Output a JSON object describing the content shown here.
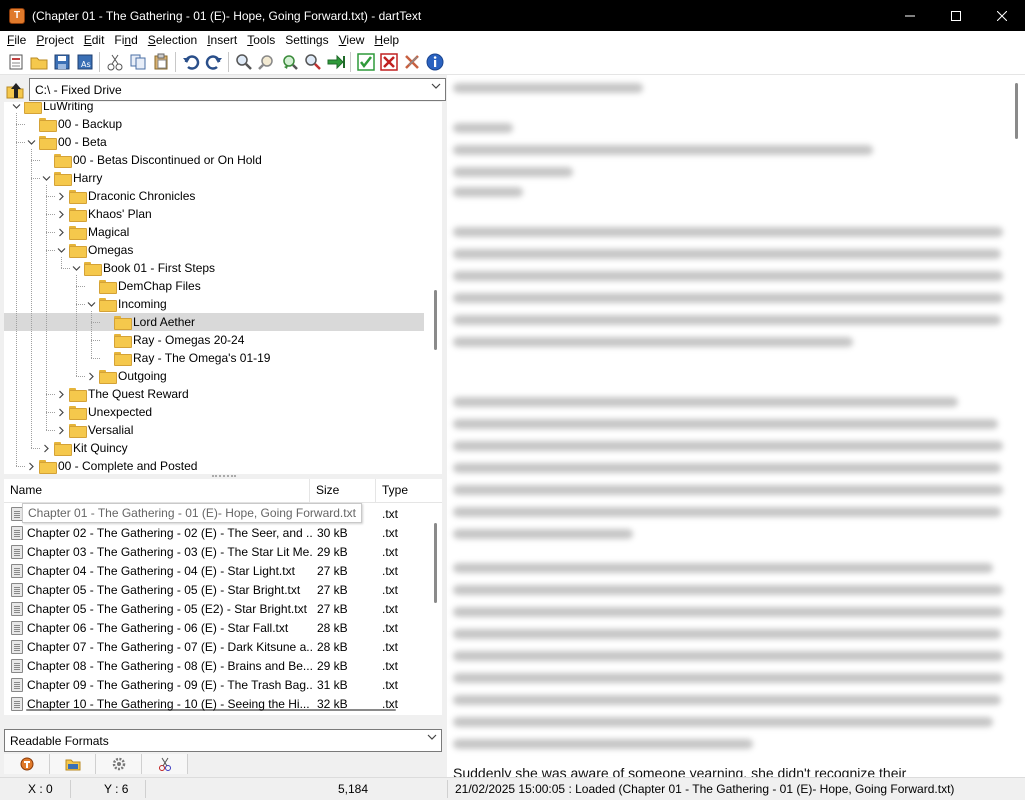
{
  "window": {
    "title": "(Chapter 01 - The Gathering - 01  (E)- Hope, Going Forward.txt) - dartText",
    "minimize": "—",
    "maximize": "☐",
    "close": "✕"
  },
  "menu": [
    {
      "label": "File",
      "key": "F"
    },
    {
      "label": "Project",
      "key": "P"
    },
    {
      "label": "Edit",
      "key": "E"
    },
    {
      "label": "Find",
      "key": "n"
    },
    {
      "label": "Selection",
      "key": "S"
    },
    {
      "label": "Insert",
      "key": "I"
    },
    {
      "label": "Tools",
      "key": "T"
    },
    {
      "label": "Settings",
      "key": "g"
    },
    {
      "label": "View",
      "key": "V"
    },
    {
      "label": "Help",
      "key": "H"
    }
  ],
  "toolbar": {
    "icons": [
      "new-document-icon",
      "open-folder-icon",
      "save-icon",
      "save-as-icon",
      "cut-icon",
      "copy-icon",
      "paste-icon",
      "undo-icon",
      "redo-icon",
      "find-icon",
      "find-next-icon",
      "replace-icon",
      "zoom-icon",
      "goto-icon",
      "accept-icon",
      "reject-icon",
      "remove-icon",
      "info-icon"
    ]
  },
  "drive": {
    "label": "C:\\ - Fixed Drive"
  },
  "tree": [
    {
      "label": "LuWriting",
      "level": 0,
      "expanded": true
    },
    {
      "label": "00 - Backup",
      "level": 1,
      "expanded": null
    },
    {
      "label": "00 - Beta",
      "level": 1,
      "expanded": true
    },
    {
      "label": "00 - Betas Discontinued or On Hold",
      "level": 2,
      "expanded": null
    },
    {
      "label": "Harry",
      "level": 2,
      "expanded": true
    },
    {
      "label": "Draconic Chronicles",
      "level": 3,
      "expanded": false
    },
    {
      "label": "Khaos' Plan",
      "level": 3,
      "expanded": false
    },
    {
      "label": "Magical",
      "level": 3,
      "expanded": false
    },
    {
      "label": "Omegas",
      "level": 3,
      "expanded": true
    },
    {
      "label": "Book 01 - First Steps",
      "level": 4,
      "expanded": true
    },
    {
      "label": "DemChap Files",
      "level": 5,
      "expanded": null
    },
    {
      "label": "Incoming",
      "level": 5,
      "expanded": true
    },
    {
      "label": "Lord Aether",
      "level": 6,
      "expanded": null,
      "selected": true
    },
    {
      "label": "Ray - Omegas 20-24",
      "level": 6,
      "expanded": null
    },
    {
      "label": "Ray - The Omega's 01-19",
      "level": 6,
      "expanded": null
    },
    {
      "label": "Outgoing",
      "level": 5,
      "expanded": false
    },
    {
      "label": "The Quest Reward",
      "level": 3,
      "expanded": false
    },
    {
      "label": "Unexpected",
      "level": 3,
      "expanded": false
    },
    {
      "label": "Versalial",
      "level": 3,
      "expanded": false
    },
    {
      "label": "Kit Quincy",
      "level": 2,
      "expanded": false
    },
    {
      "label": "00 - Complete and Posted",
      "level": 1,
      "expanded": false
    }
  ],
  "files": {
    "headers": {
      "name": "Name",
      "size": "Size",
      "type": "Type"
    },
    "tooltip": "Chapter 01 - The Gathering - 01  (E)- Hope, Going Forward.txt",
    "rows": [
      {
        "name": "Chapter 01 - The Gathering - 01  (E)- Hope, Going Forward.txt",
        "size": "",
        "type": ".txt"
      },
      {
        "name": "Chapter 02 - The Gathering - 02 (E) - The Seer, and ...",
        "size": "30 kB",
        "type": ".txt"
      },
      {
        "name": "Chapter 03 - The Gathering - 03 (E) - The Star Lit Me...",
        "size": "29 kB",
        "type": ".txt"
      },
      {
        "name": "Chapter 04 - The Gathering - 04 (E) - Star Light.txt",
        "size": "27 kB",
        "type": ".txt"
      },
      {
        "name": "Chapter 05 - The Gathering - 05  (E) - Star Bright.txt",
        "size": "27 kB",
        "type": ".txt"
      },
      {
        "name": "Chapter 05 - The Gathering - 05  (E2) - Star Bright.txt",
        "size": "27 kB",
        "type": ".txt"
      },
      {
        "name": "Chapter 06 - The Gathering - 06 (E)  - Star Fall.txt",
        "size": "28 kB",
        "type": ".txt"
      },
      {
        "name": "Chapter 07 - The Gathering - 07  (E) - Dark Kitsune a...",
        "size": "28 kB",
        "type": ".txt"
      },
      {
        "name": "Chapter 08 - The Gathering - 08 (E)  - Brains and Be...",
        "size": "29 kB",
        "type": ".txt"
      },
      {
        "name": "Chapter 09 - The Gathering - 09 (E)  - The Trash Bag...",
        "size": "31 kB",
        "type": ".txt"
      },
      {
        "name": "Chapter 10 - The Gathering - 10 (E)  - Seeing the Hi...",
        "size": "32 kB",
        "type": ".txt"
      }
    ]
  },
  "format": {
    "label": "Readable Formats"
  },
  "left_tabs": [
    "app-tab-icon",
    "folder-tab-icon",
    "gear-tab-icon",
    "clip-tab-icon"
  ],
  "editor": {
    "bottom_text": "Suddenly she was aware of someone yearning, she didn't recognize their"
  },
  "status": {
    "x": "X : 0",
    "y": "Y : 6",
    "count": "5,184",
    "message": "21/02/2025 15:00:05 : Loaded (Chapter 01 - The Gathering - 01  (E)- Hope, Going Forward.txt)"
  }
}
